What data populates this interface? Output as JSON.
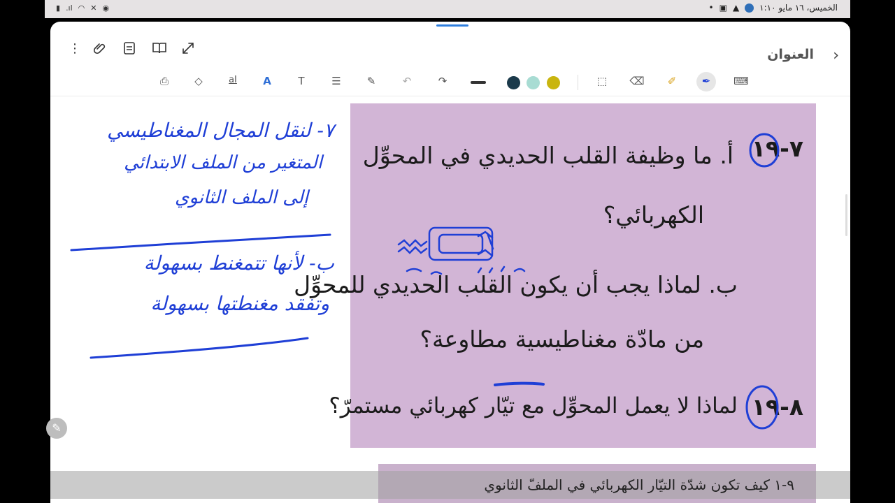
{
  "status": {
    "datetime": "الخميس، ١٦ مايو ١:١٠"
  },
  "header": {
    "back_icon": "chevron-right-icon",
    "title": "العنوان",
    "icons": [
      "more-vertical-icon",
      "attachment-icon",
      "document-icon",
      "book-icon",
      "expand-icon"
    ]
  },
  "toolbar": {
    "tools": [
      "lasso-lock-icon",
      "shapes-icon",
      "text-spacing-icon",
      "handwriting-text-icon",
      "text-icon",
      "align-icon",
      "pencil-plus-icon",
      "undo-icon",
      "redo-icon",
      "stroke-width-icon",
      "select-box-icon",
      "eraser-icon",
      "highlighter-icon",
      "pen-icon",
      "keyboard-icon"
    ],
    "colors": [
      "#1b3a4b",
      "#a8dcd3",
      "#c9b50f"
    ]
  },
  "page": {
    "q_a_num": "٧-١٩",
    "q_a_line1": "أ.  ما وظيفة القلب الحديدي في المحوِّل",
    "q_a_line2": "الكهربائي؟",
    "q_b_line1": "ب.  لماذا يجب أن يكون القلب الحديدي للمحوِّل",
    "q_b_line2": "من مادّة مغناطيسية مطاوعة؟",
    "q_c_num": "٨-١٩",
    "q_c_line": "لماذا لا يعمل المحوِّل مع تيّار كهربائي مستمرّ؟",
    "next_text": "٩-١  كيف تكون شدّة التيّار الكهربائي في الملفّ الثانوي"
  },
  "handwriting": {
    "note1_line1": "٧- لنقل المجال المغناطيسي",
    "note1_line2": "المتغير من الملف الابتدائي",
    "note1_line3": "إلى الملف الثانوي",
    "note2_line1": "ب- لأنها تتمغنط بسهولة",
    "note2_line2": "وتفقد مغنطتها بسهولة"
  },
  "colors": {
    "page_bg": "#d2b5d6",
    "ink_blue": "#1f3fd6",
    "accent": "#2f7fde"
  }
}
